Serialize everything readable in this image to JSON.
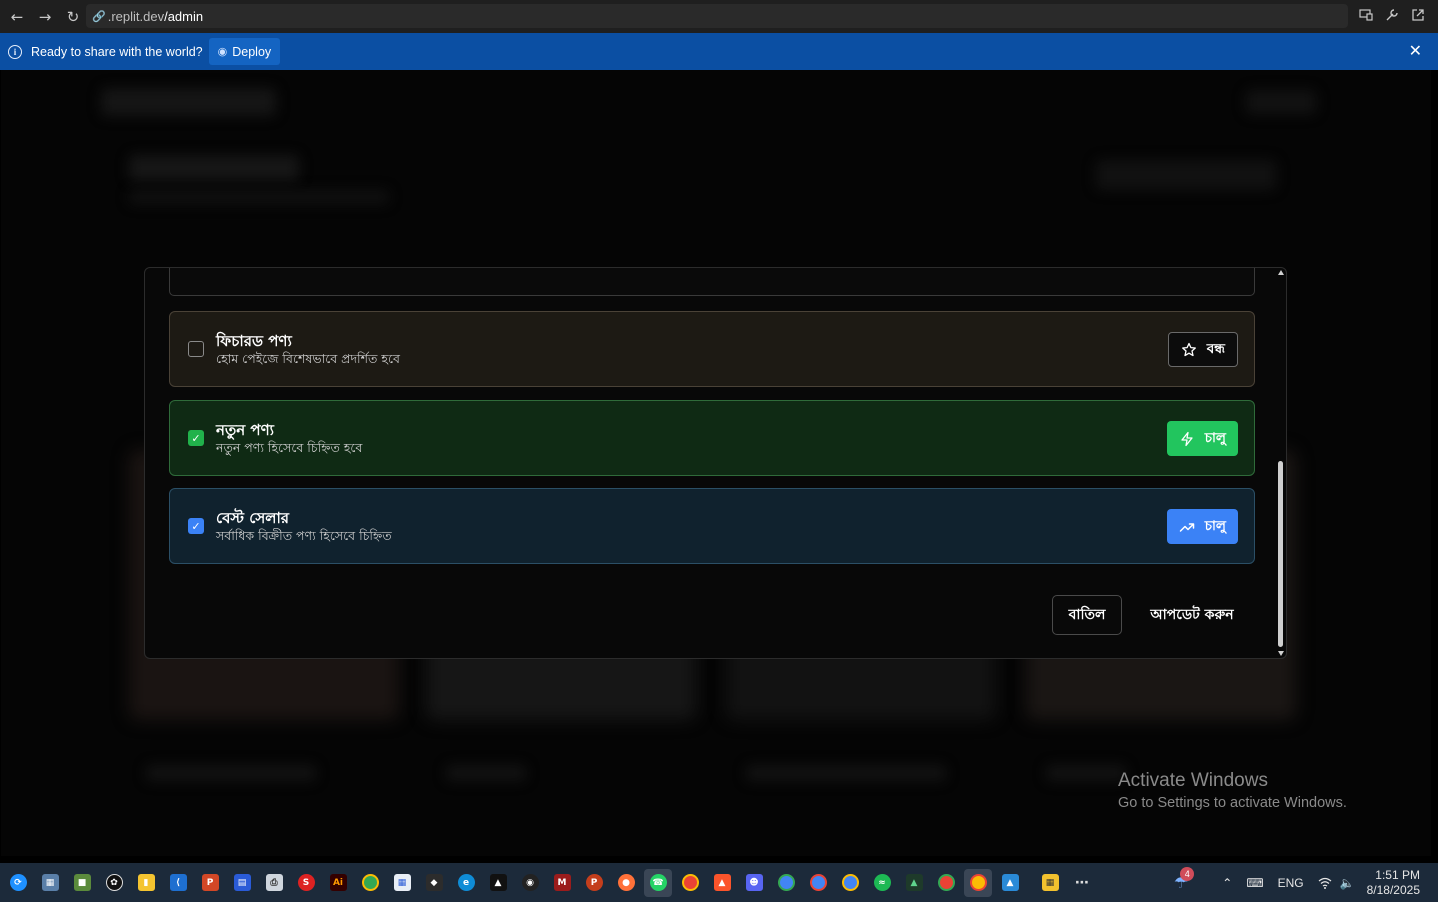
{
  "browser": {
    "url_prefix": ".replit.dev",
    "url_path": "/admin"
  },
  "banner": {
    "message": "Ready to share with the world?",
    "deploy_label": "Deploy"
  },
  "modal": {
    "options": [
      {
        "title": "ফিচারড পণ্য",
        "description": "হোম পেইজে বিশেষভাবে প্রদর্শিত হবে",
        "checked": false,
        "toggle_label": "বন্ধ",
        "icon": "star-icon"
      },
      {
        "title": "নতুন পণ্য",
        "description": "নতুন পণ্য হিসেবে চিহ্নিত হবে",
        "checked": true,
        "toggle_label": "চালু",
        "icon": "lightning-icon"
      },
      {
        "title": "বেস্ট সেলার",
        "description": "সর্বাধিক বিক্রীত পণ্য হিসেবে চিহ্নিত",
        "checked": true,
        "toggle_label": "চালু",
        "icon": "trending-up-icon"
      }
    ],
    "cancel_label": "বাতিল",
    "update_label": "আপডেট করুন"
  },
  "watermark": {
    "title": "Activate Windows",
    "subtitle": "Go to Settings to activate Windows."
  },
  "taskbar": {
    "notification_count": "4",
    "language": "ENG",
    "time": "1:51 PM",
    "date": "8/18/2025"
  },
  "colors": {
    "banner": "#0b4fa3",
    "green_accent": "#22c55e",
    "blue_accent": "#3b82f6"
  }
}
